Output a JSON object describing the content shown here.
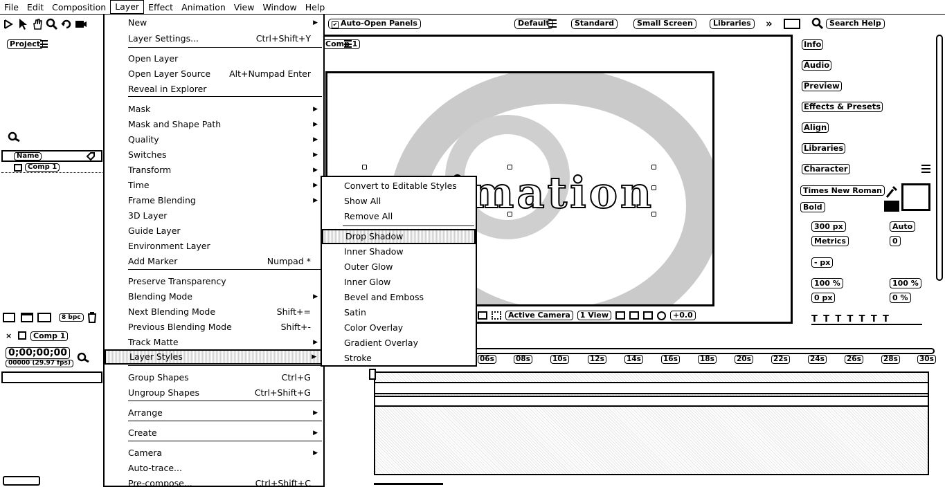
{
  "menubar": {
    "items": [
      "File",
      "Edit",
      "Composition",
      "Layer",
      "Effect",
      "Animation",
      "View",
      "Window",
      "Help"
    ]
  },
  "toolbar": {
    "auto_open_panels": "Auto-Open Panels",
    "workspaces": [
      "Default",
      "Standard",
      "Small Screen",
      "Libraries"
    ],
    "search_help": "Search Help"
  },
  "project_panel": {
    "title": "Project",
    "name_column": "Name",
    "item": "Comp 1",
    "bpc": "8 bpc"
  },
  "viewer": {
    "tab": "Comp 1",
    "text": "Animation",
    "active_camera": "Active Camera",
    "view_count": "1 View",
    "exposure": "+0.0"
  },
  "right_panel": {
    "items": [
      "Info",
      "Audio",
      "Preview",
      "Effects & Presets",
      "Align",
      "Libraries",
      "Character"
    ],
    "character": {
      "font": "Times New Roman",
      "style": "Bold",
      "size": "300 px",
      "leading": "Auto",
      "kerning": "Metrics",
      "tracking": "0",
      "stroke": "- px",
      "vscale": "100 %",
      "hscale": "100 %",
      "baseline": "0 px",
      "tsume": "0 %"
    }
  },
  "timeline": {
    "comp_tab": "Comp 1",
    "timecode": "0;00;00;00",
    "fps": "00000 (29.97 fps)",
    "ticks": [
      "06s",
      "08s",
      "10s",
      "12s",
      "14s",
      "16s",
      "18s",
      "20s",
      "22s",
      "24s",
      "26s",
      "28s",
      "30s"
    ]
  },
  "layer_menu": {
    "rows": [
      {
        "label": "New",
        "shortcut": "",
        "arrow": true
      },
      {
        "label": "Layer Settings...",
        "shortcut": "Ctrl+Shift+Y",
        "arrow": false
      },
      {
        "label": "Open Layer",
        "shortcut": "",
        "arrow": false
      },
      {
        "label": "Open Layer Source",
        "shortcut": "Alt+Numpad Enter",
        "arrow": false
      },
      {
        "label": "Reveal in Explorer",
        "shortcut": "",
        "arrow": false
      },
      {
        "label": "Mask",
        "shortcut": "",
        "arrow": true
      },
      {
        "label": "Mask and Shape Path",
        "shortcut": "",
        "arrow": true
      },
      {
        "label": "Quality",
        "shortcut": "",
        "arrow": true
      },
      {
        "label": "Switches",
        "shortcut": "",
        "arrow": true
      },
      {
        "label": "Transform",
        "shortcut": "",
        "arrow": true
      },
      {
        "label": "Time",
        "shortcut": "",
        "arrow": true
      },
      {
        "label": "Frame Blending",
        "shortcut": "",
        "arrow": true
      },
      {
        "label": "3D Layer",
        "shortcut": "",
        "arrow": false
      },
      {
        "label": "Guide Layer",
        "shortcut": "",
        "arrow": false
      },
      {
        "label": "Environment Layer",
        "shortcut": "",
        "arrow": false
      },
      {
        "label": "Add Marker",
        "shortcut": "Numpad *",
        "arrow": false
      },
      {
        "label": "Preserve Transparency",
        "shortcut": "",
        "arrow": false
      },
      {
        "label": "Blending Mode",
        "shortcut": "",
        "arrow": true
      },
      {
        "label": "Next Blending Mode",
        "shortcut": "Shift+=",
        "arrow": false
      },
      {
        "label": "Previous Blending Mode",
        "shortcut": "Shift+-",
        "arrow": false
      },
      {
        "label": "Track Matte",
        "shortcut": "",
        "arrow": true
      },
      {
        "label": "Layer Styles",
        "shortcut": "",
        "arrow": true
      },
      {
        "label": "Group Shapes",
        "shortcut": "Ctrl+G",
        "arrow": false
      },
      {
        "label": "Ungroup Shapes",
        "shortcut": "Ctrl+Shift+G",
        "arrow": false
      },
      {
        "label": "Arrange",
        "shortcut": "",
        "arrow": true
      },
      {
        "label": "Create",
        "shortcut": "",
        "arrow": true
      },
      {
        "label": "Camera",
        "shortcut": "",
        "arrow": true
      },
      {
        "label": "Auto-trace...",
        "shortcut": "",
        "arrow": false
      },
      {
        "label": "Pre-compose...",
        "shortcut": "Ctrl+Shift+C",
        "arrow": false
      }
    ]
  },
  "layer_styles_menu": {
    "rows": [
      "Convert to Editable Styles",
      "Show All",
      "Remove All",
      "Drop Shadow",
      "Inner Shadow",
      "Outer Glow",
      "Inner Glow",
      "Bevel and Emboss",
      "Satin",
      "Color Overlay",
      "Gradient Overlay",
      "Stroke"
    ]
  }
}
